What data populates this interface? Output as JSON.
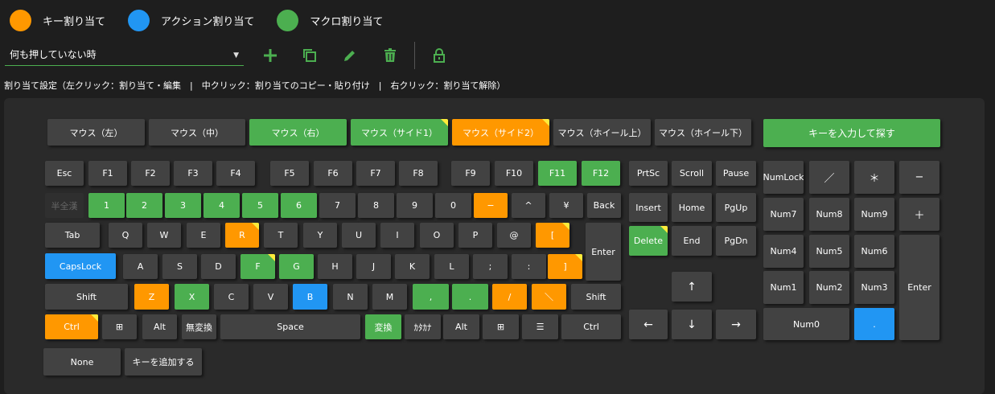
{
  "legend": {
    "key_assign": {
      "label": "キー割り当て",
      "color": "#ff9800"
    },
    "action_assign": {
      "label": "アクション割り当て",
      "color": "#2196f3"
    },
    "macro_assign": {
      "label": "マクロ割り当て",
      "color": "#4caf50"
    }
  },
  "toolbar": {
    "profile_value": "何も押していない時",
    "icons": [
      "plus-icon",
      "copy-icon",
      "pencil-icon",
      "trash-icon",
      "lock-icon"
    ],
    "accent": "#4caf50"
  },
  "hint": "割り当て設定（左クリック：割り当て・編集　|　中クリック：割り当てのコピー・貼り付け　|　右クリック：割り当て解除）",
  "mouse": {
    "left": "マウス（左）",
    "middle": "マウス（中）",
    "right": "マウス（右）",
    "side1": "マウス（サイド1）",
    "side2": "マウス（サイド2）",
    "wheel_up": "マウス（ホイール上）",
    "wheel_down": "マウス（ホイール下）",
    "search": "キーを入力して探す"
  },
  "keys": {
    "esc": "Esc",
    "f1": "F1",
    "f2": "F2",
    "f3": "F3",
    "f4": "F4",
    "f5": "F5",
    "f6": "F6",
    "f7": "F7",
    "f8": "F8",
    "f9": "F9",
    "f10": "F10",
    "f11": "F11",
    "f12": "F12",
    "hankaku": "半全漢",
    "n1": "1",
    "n2": "2",
    "n3": "3",
    "n4": "4",
    "n5": "5",
    "n6": "6",
    "n7": "7",
    "n8": "8",
    "n9": "9",
    "n0": "0",
    "minus": "−",
    "caret": "^",
    "yen": "¥",
    "back": "Back",
    "tab": "Tab",
    "q": "Q",
    "w": "W",
    "e": "E",
    "r": "R",
    "t": "T",
    "y": "Y",
    "u": "U",
    "i": "I",
    "o": "O",
    "p": "P",
    "at": "@",
    "lbracket": "[",
    "enter": "Enter",
    "capslock": "CapsLock",
    "a": "A",
    "s": "S",
    "d": "D",
    "f": "F",
    "g": "G",
    "h": "H",
    "j": "J",
    "k": "K",
    "l": "L",
    "semicolon": ";",
    "colon": ":",
    "rbracket": "]",
    "lshift": "Shift",
    "z": "Z",
    "x": "X",
    "c": "C",
    "v": "V",
    "b": "B",
    "n": "N",
    "m": "M",
    "comma": ",",
    "period": ".",
    "slash": "/",
    "backslash": "＼",
    "rshift": "Shift",
    "lctrl": "Ctrl",
    "lwin": "⊞",
    "lalt": "Alt",
    "muhenkan": "無変換",
    "space": "Space",
    "henkan": "変換",
    "kana": "ｶﾀｶﾅ",
    "ralt": "Alt",
    "rwin": "⊞",
    "menu": "☰",
    "rctrl": "Ctrl",
    "prtsc": "PrtSc",
    "scroll": "Scroll",
    "pause": "Pause",
    "insert": "Insert",
    "home": "Home",
    "pgup": "PgUp",
    "delete": "Delete",
    "end": "End",
    "pgdn": "PgDn",
    "up": "↑",
    "left": "←",
    "down": "↓",
    "right": "→",
    "numlock": "NumLock",
    "numdiv": "／",
    "nummul": "＊",
    "numsub": "−",
    "num7": "Num7",
    "num8": "Num8",
    "num9": "Num9",
    "numadd": "＋",
    "num4": "Num4",
    "num5": "Num5",
    "num6": "Num6",
    "num1": "Num1",
    "num2": "Num2",
    "num3": "Num3",
    "numenter": "Enter",
    "num0": "Num0",
    "numdot": "."
  },
  "bottom": {
    "none": "None",
    "add_key": "キーを追加する"
  }
}
